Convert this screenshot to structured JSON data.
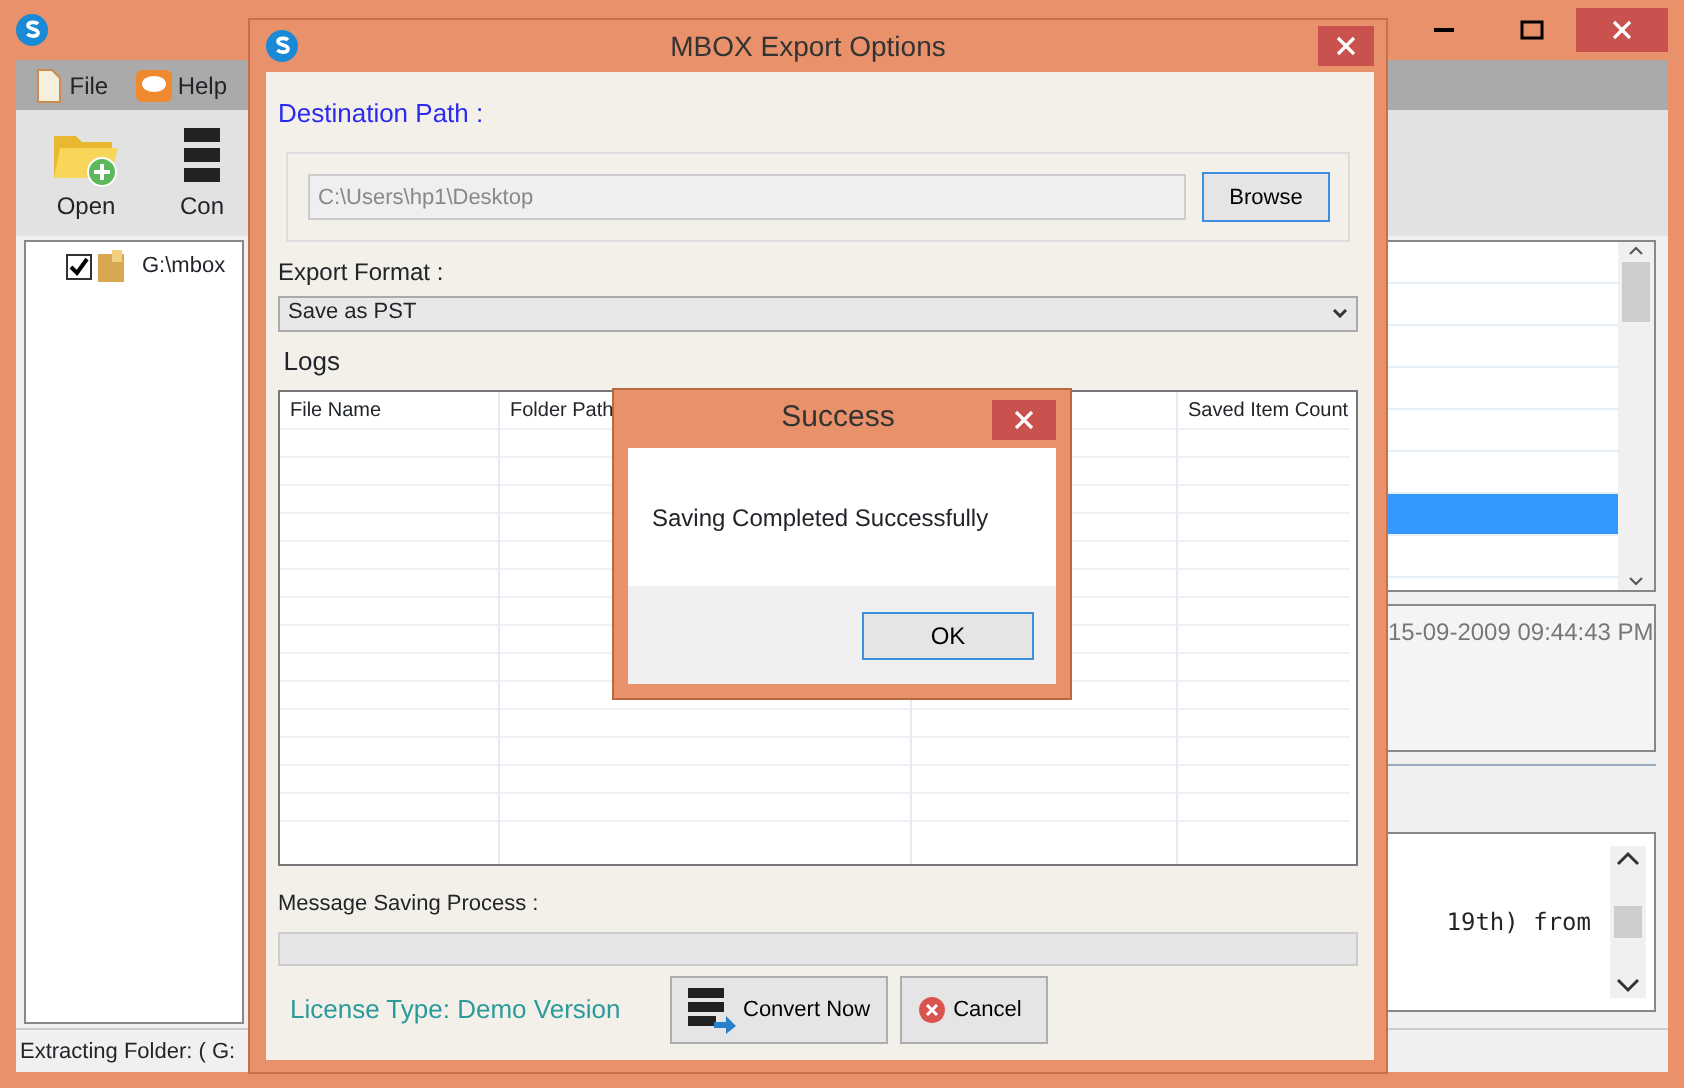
{
  "main_window": {
    "menu": [
      {
        "label": "File"
      },
      {
        "label": "Help"
      }
    ],
    "toolbar": [
      {
        "label": "Open"
      },
      {
        "label": "Con"
      }
    ],
    "tree": [
      {
        "label": "G:\\mbox",
        "checked": true
      }
    ],
    "list_rows": [
      {
        "selected": false
      },
      {
        "selected": false
      },
      {
        "selected": false
      },
      {
        "selected": false
      },
      {
        "selected": false
      },
      {
        "selected": false
      },
      {
        "selected": true
      },
      {
        "selected": false
      }
    ],
    "date": "15-09-2009 09:44:43 PM",
    "preview_text": "19th) from",
    "status_bar": "Extracting Folder: ( G:"
  },
  "export_dialog": {
    "title": "MBOX Export Options",
    "destination_label": "Destination Path :",
    "path_value": "C:\\Users\\hp1\\Desktop",
    "browse_button": "Browse",
    "format_label": "Export Format :",
    "format_value": "Save as PST",
    "logs_label": "Logs",
    "columns": [
      {
        "label": "File Name"
      },
      {
        "label": "Folder Path"
      },
      {
        "label": "Saved Item Count"
      }
    ],
    "progress_label": "Message Saving Process :",
    "progress": {
      "level": 0
    },
    "license": "License Type: Demo Version",
    "convert_button": "Convert Now",
    "cancel_button": "Cancel"
  },
  "success_dialog": {
    "title": "Success",
    "message": "Saving Completed Successfully",
    "ok_button": "OK"
  }
}
